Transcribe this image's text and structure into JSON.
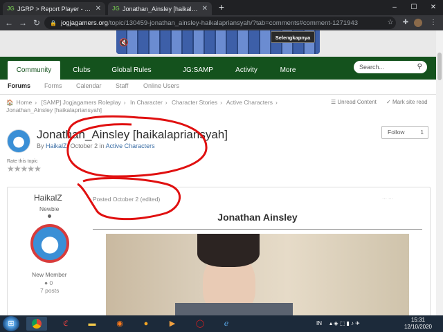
{
  "browser": {
    "tabs": [
      {
        "label": "JGRP > Report Player - Jogjagan",
        "favicon": "JG"
      },
      {
        "label": "Jonathan_Ainsley [haikalapriansyah]",
        "favicon": "JG"
      }
    ],
    "new_tab": "+",
    "url_host": "jogjagamers.org",
    "url_path": "/topic/130459-jonathan_ainsley-haikalapriansyah/?tab=comments#comment-1271943",
    "window_controls": [
      "–",
      "☐",
      "✕"
    ]
  },
  "ad": {
    "cta_label": "Selengkapnya",
    "icon": "mute-icon"
  },
  "nav": {
    "tabs": [
      "Community",
      "Clubs",
      "Global Rules",
      "JG:SAMP Links",
      "Activity",
      "More"
    ],
    "active": "Community",
    "search_placeholder": "Search...",
    "subnav": [
      "Forums",
      "Forms",
      "Calendar",
      "Staff",
      "Online Users"
    ]
  },
  "breadcrumb": {
    "line1": [
      "Home",
      "[SAMP] Jogjagamers Roleplay",
      "In Character",
      "Character Stories",
      "Active Characters"
    ],
    "line2": "Jonathan_Ainsley [haikalapriansyah]",
    "unread": "Unread Content",
    "mark_read": "Mark site read"
  },
  "topic": {
    "title": "Jonathan_Ainsley [haikalapriansyah]",
    "by": "By",
    "author": "HaikalZ",
    "date_text": "October 2 in",
    "forum": "Active Characters",
    "follow_label": "Follow",
    "follow_count": "1",
    "rate_label": "Rate this topic",
    "stars": "★★★★★"
  },
  "post": {
    "author": "HaikalZ",
    "rank": "Newbie",
    "group": "New Member",
    "reputation": "0",
    "post_count": "7 posts",
    "posted": "Posted October 2 (edited)",
    "heading": "Jonathan Ainsley"
  },
  "taskbar": {
    "apps": [
      "chrome-icon",
      "ccleaner-icon",
      "folder-icon",
      "firefox-icon",
      "app-icon",
      "media-icon",
      "opera-icon",
      "ie-icon"
    ],
    "lang": "IN",
    "time": "15:31",
    "date": "12/10/2020"
  },
  "colors": {
    "nav_green": "#14521d",
    "scribble_red": "#e01010",
    "link_blue": "#3b6ea5"
  }
}
